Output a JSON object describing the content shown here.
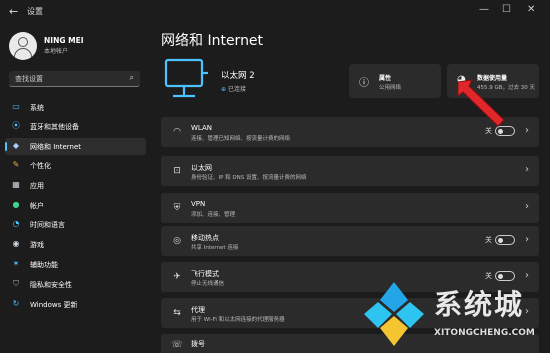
{
  "window": {
    "title": "设置",
    "back": "←",
    "minimize": "—",
    "maximize": "☐",
    "close": "✕"
  },
  "user": {
    "name": "NING MEI",
    "account": "本地帐户"
  },
  "search": {
    "placeholder": "查找设置",
    "icon": "search-icon"
  },
  "sidebar": {
    "items": [
      {
        "label": "系统",
        "icon": "monitor-icon",
        "active": false,
        "color": "#4cc2ff"
      },
      {
        "label": "蓝牙和其他设备",
        "icon": "bluetooth-icon",
        "active": false,
        "color": "#4cc2ff"
      },
      {
        "label": "网络和 Internet",
        "icon": "network-icon",
        "active": true,
        "color": "#aaccff"
      },
      {
        "label": "个性化",
        "icon": "brush-icon",
        "active": false,
        "color": "#f2b544"
      },
      {
        "label": "应用",
        "icon": "apps-icon",
        "active": false,
        "color": "#cfd8e3"
      },
      {
        "label": "帐户",
        "icon": "person-icon",
        "active": false,
        "color": "#3fd28b"
      },
      {
        "label": "时间和语言",
        "icon": "globe-clock-icon",
        "active": false,
        "color": "#4cc2ff"
      },
      {
        "label": "游戏",
        "icon": "gamepad-icon",
        "active": false,
        "color": "#cfd8e3"
      },
      {
        "label": "辅助功能",
        "icon": "accessibility-icon",
        "active": false,
        "color": "#4cc2ff"
      },
      {
        "label": "隐私和安全性",
        "icon": "shield-icon",
        "active": false,
        "color": "#aaaaaa"
      },
      {
        "label": "Windows 更新",
        "icon": "update-icon",
        "active": false,
        "color": "#4cc2ff"
      }
    ]
  },
  "main": {
    "title": "网络和 Internet",
    "connection": {
      "name": "以太网 2",
      "status": "已连接"
    },
    "properties": {
      "title": "属性",
      "subtitle": "公用网络",
      "icon": "info-icon"
    },
    "data_usage": {
      "title": "数据使用量",
      "subtitle": "455.9 GB，过去 30 天",
      "icon": "pie-icon"
    },
    "rows": [
      {
        "title": "WLAN",
        "desc": "连接、管理已知网络、按流量计费的网络",
        "icon": "wifi-icon",
        "state": "关",
        "toggle": true
      },
      {
        "title": "以太网",
        "desc": "身份验证、IP 和 DNS 设置、按流量计费的网络",
        "icon": "ethernet-icon",
        "state": "",
        "toggle": false
      },
      {
        "title": "VPN",
        "desc": "添加、连接、管理",
        "icon": "vpn-shield-icon",
        "state": "",
        "toggle": false
      },
      {
        "title": "移动热点",
        "desc": "共享 Internet 连接",
        "icon": "hotspot-icon",
        "state": "关",
        "toggle": true
      },
      {
        "title": "飞行模式",
        "desc": "停止无线通信",
        "icon": "airplane-icon",
        "state": "关",
        "toggle": true
      },
      {
        "title": "代理",
        "desc": "用于 Wi-Fi 和以太网连接的代理服务器",
        "icon": "proxy-icon",
        "state": "",
        "toggle": false
      },
      {
        "title": "拨号",
        "desc": "",
        "icon": "dialup-icon",
        "state": "",
        "toggle": false
      }
    ]
  },
  "watermark": {
    "text": "系统城",
    "url": "XITONGCHENG.COM"
  },
  "colors": {
    "accent": "#4cc2ff",
    "annotation_arrow": "#e0282c"
  }
}
